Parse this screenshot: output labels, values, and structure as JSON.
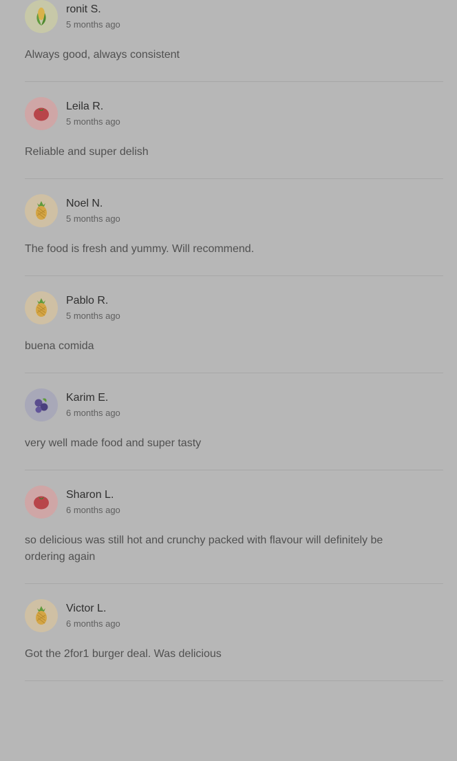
{
  "reviews": [
    {
      "name": "ronit S.",
      "time": "5 months ago",
      "text": "Always good, always consistent",
      "avatar": "corn-icon",
      "avatar_bg": "#c7c8a8"
    },
    {
      "name": "Leila R.",
      "time": "5 months ago",
      "text": "Reliable and super delish",
      "avatar": "tomato-icon",
      "avatar_bg": "#cfa6a6"
    },
    {
      "name": "Noel N.",
      "time": "5 months ago",
      "text": "The food is fresh and yummy. Will recommend.",
      "avatar": "pineapple-icon",
      "avatar_bg": "#cfc0a4"
    },
    {
      "name": "Pablo R.",
      "time": "5 months ago",
      "text": "buena comida",
      "avatar": "pineapple-icon",
      "avatar_bg": "#cfc0a4"
    },
    {
      "name": "Karim E.",
      "time": "6 months ago",
      "text": "very well made food and super tasty",
      "avatar": "blueberry-icon",
      "avatar_bg": "#a8a8b8"
    },
    {
      "name": "Sharon L.",
      "time": "6 months ago",
      "text": "so delicious was still hot and crunchy packed with flavour will definitely be ordering again",
      "avatar": "tomato-icon",
      "avatar_bg": "#cfa6a6"
    },
    {
      "name": "Victor L.",
      "time": "6 months ago",
      "text": "Got the 2for1 burger deal. Was delicious",
      "avatar": "pineapple-icon",
      "avatar_bg": "#cfc0a4"
    }
  ]
}
